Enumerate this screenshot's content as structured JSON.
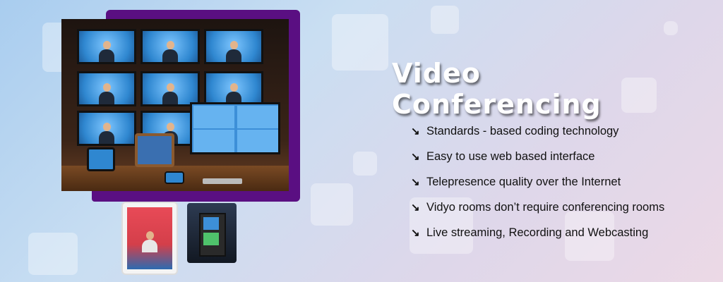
{
  "title": "Video Conferencing",
  "features": [
    {
      "text": "Standards - based coding technology",
      "icon": "arrow-down-right-icon"
    },
    {
      "text": "Easy to use web based interface",
      "icon": "arrow-down-right-icon"
    },
    {
      "text": "Telepresence quality over the Internet",
      "icon": "arrow-down-right-icon"
    },
    {
      "text": "Vidyo rooms don’t require conferencing rooms",
      "icon": "arrow-down-right-icon"
    },
    {
      "text": "Live streaming, Recording and Webcasting",
      "icon": "arrow-down-right-icon"
    }
  ],
  "colors": {
    "accent_purple": "#5a0f82",
    "title_text": "#ffffff",
    "body_text": "#111111"
  }
}
